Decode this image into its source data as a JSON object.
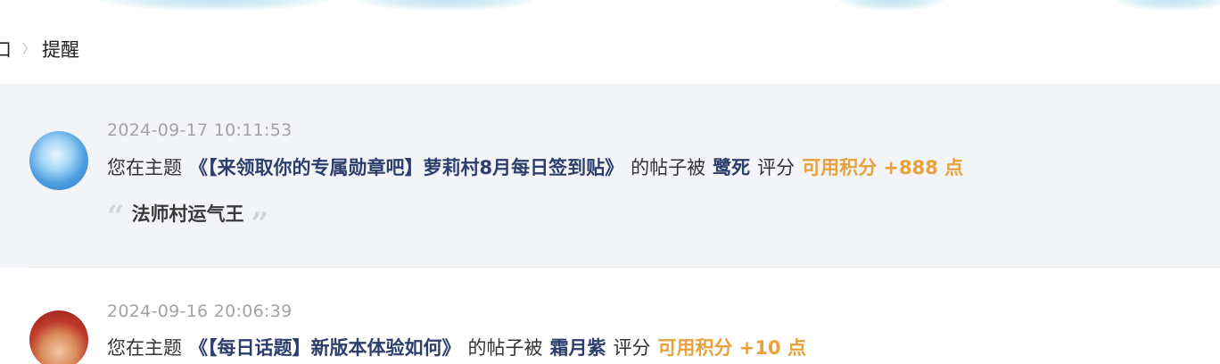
{
  "breadcrumb": {
    "previous": "口",
    "separator": "〉",
    "current": "提醒"
  },
  "notices": [
    {
      "time": "2024-09-17 10:11:53",
      "prefix": "您在主题",
      "thread": "《【来领取你的专属勋章吧】萝莉村8月每日签到贴》",
      "mid": "的帖子被",
      "user": "鹭死",
      "action": "评分",
      "points": "可用积分 +888 点",
      "quote": "法师村运气王"
    },
    {
      "time": "2024-09-16 20:06:39",
      "prefix": "您在主题",
      "thread": "《【每日话题】新版本体验如何》",
      "mid": "的帖子被",
      "user": "霜月紫",
      "action": "评分",
      "points": "可用积分 +10 点"
    }
  ],
  "quote_marks": {
    "open": "“",
    "close": "”"
  },
  "colors": {
    "link": "#2c3e6b",
    "points": "#e8a13b",
    "highlight_bg": "#f2f4f8",
    "time": "#a3a3a3"
  }
}
